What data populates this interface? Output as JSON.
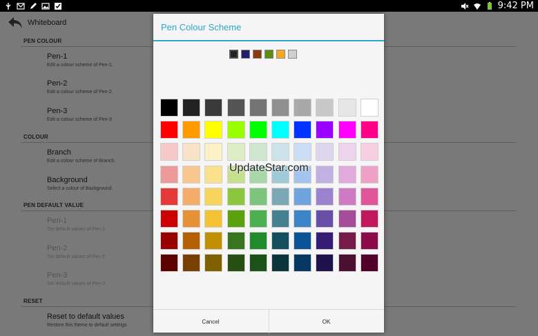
{
  "status_bar": {
    "left_icons": [
      "usb-icon",
      "email-icon",
      "pen-icon",
      "image-icon",
      "check-icon"
    ],
    "right_icons": [
      "mute-icon",
      "wifi-icon",
      "battery-icon"
    ],
    "time": "9:42 PM"
  },
  "action_bar": {
    "title": "Whiteboard",
    "back_icon": "back-arrow-icon"
  },
  "settings": {
    "sections": [
      {
        "header": "PEN COLOUR",
        "items": [
          {
            "title": "Pen-1",
            "summary": "Edit a colour scheme of Pen-1.",
            "enabled": true
          },
          {
            "title": "Pen-2",
            "summary": "Edit a colour scheme of Pen-2.",
            "enabled": true
          },
          {
            "title": "Pen-3",
            "summary": "Edit a colour scheme of Pen-3",
            "enabled": true
          }
        ]
      },
      {
        "header": "COLOUR",
        "items": [
          {
            "title": "Branch",
            "summary": "Edit a colour scheme of Branch.",
            "enabled": true
          },
          {
            "title": "Background",
            "summary": "Select a colour of Background.",
            "enabled": true
          }
        ]
      },
      {
        "header": "PEN DEFAULT VALUE",
        "items": [
          {
            "title": "Pen-1",
            "summary": "Set default values of Pen-1.",
            "enabled": false
          },
          {
            "title": "Pen-2",
            "summary": "Set default values of Pen-2.",
            "enabled": false
          },
          {
            "title": "Pen-3",
            "summary": "Set default values of Pen-3.",
            "enabled": false
          }
        ]
      },
      {
        "header": "RESET",
        "items": [
          {
            "title": "Reset to default values",
            "summary": "Restore this theme to default settings",
            "enabled": true
          }
        ]
      }
    ]
  },
  "dialog": {
    "title": "Pen Colour Scheme",
    "current_scheme": [
      "#222222",
      "#1f1f6b",
      "#8a3a0c",
      "#5c8c16",
      "#f5a623",
      "#cfcfcf"
    ],
    "palette": [
      [
        "#000000",
        "#222222",
        "#3a3a3a",
        "#555555",
        "#747474",
        "#909090",
        "#a9a9a9",
        "#c8c8c8",
        "#e6e6e6",
        "#ffffff"
      ],
      [
        "#ff0000",
        "#ff9900",
        "#ffff00",
        "#99ff00",
        "#00ff00",
        "#00ffff",
        "#0033ff",
        "#9900ff",
        "#ff00ff",
        "#ff0088"
      ],
      [
        "#f5c9c9",
        "#f8e3c8",
        "#fbf1c4",
        "#dcecc4",
        "#cfe7cf",
        "#cde3ea",
        "#cbdcf5",
        "#ddd4ee",
        "#eed3ec",
        "#f6cfe1"
      ],
      [
        "#eb9999",
        "#f7c58f",
        "#f9e08a",
        "#c5e08c",
        "#a8d8a8",
        "#9fcbd6",
        "#a4c4ee",
        "#c0b1e2",
        "#e1a9dc",
        "#eca1c5"
      ],
      [
        "#e63838",
        "#f3ac6a",
        "#f7d35c",
        "#8cc63f",
        "#7ec47e",
        "#7aa8b5",
        "#6fa4dc",
        "#9c83cf",
        "#cf7bc4",
        "#e1559b"
      ],
      [
        "#cc0000",
        "#e69138",
        "#f1c232",
        "#5aa10f",
        "#4caf50",
        "#45818e",
        "#3d85c6",
        "#674ea7",
        "#a64d9a",
        "#c2185b"
      ],
      [
        "#990000",
        "#b45f06",
        "#bf9000",
        "#38761d",
        "#218a2b",
        "#134f5c",
        "#0b5394",
        "#351c75",
        "#741b47",
        "#8b0b4b"
      ],
      [
        "#5c0000",
        "#783f04",
        "#7f6000",
        "#274e13",
        "#1a5217",
        "#0c343d",
        "#073763",
        "#20124d",
        "#4c1130",
        "#52002b"
      ]
    ],
    "cancel_label": "Cancel",
    "ok_label": "OK"
  },
  "watermark": "UpdateStar.com"
}
